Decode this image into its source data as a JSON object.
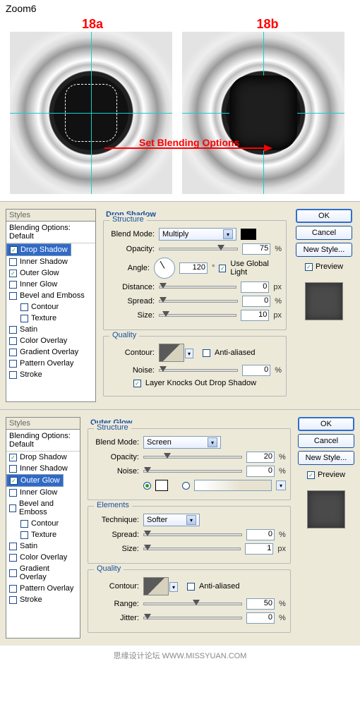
{
  "header": {
    "zoom": "Zoom6",
    "badges": [
      "18a",
      "18b"
    ],
    "arrow_label": "Set Blending Options"
  },
  "panels": [
    {
      "styles_title": "Styles",
      "blending_options": "Blending Options: Default",
      "items": [
        {
          "label": "Drop Shadow",
          "checked": true,
          "selected": true
        },
        {
          "label": "Inner Shadow",
          "checked": false
        },
        {
          "label": "Outer Glow",
          "checked": true
        },
        {
          "label": "Inner Glow",
          "checked": false
        },
        {
          "label": "Bevel and Emboss",
          "checked": false
        },
        {
          "label": "Contour",
          "checked": false,
          "indent": 1
        },
        {
          "label": "Texture",
          "checked": false,
          "indent": 1
        },
        {
          "label": "Satin",
          "checked": false
        },
        {
          "label": "Color Overlay",
          "checked": false
        },
        {
          "label": "Gradient Overlay",
          "checked": false
        },
        {
          "label": "Pattern Overlay",
          "checked": false
        },
        {
          "label": "Stroke",
          "checked": false
        }
      ],
      "title": "Drop Shadow",
      "structure": {
        "legend": "Structure",
        "blend_mode_label": "Blend Mode:",
        "blend_mode": "Multiply",
        "swatch": "#000000",
        "opacity_label": "Opacity:",
        "opacity": "75",
        "opacity_unit": "%",
        "opacity_pos": "74%",
        "angle_label": "Angle:",
        "angle": "120",
        "angle_unit": "°",
        "global_light_label": "Use Global Light",
        "global_light": true,
        "distance_label": "Distance:",
        "distance": "0",
        "distance_unit": "px",
        "distance_pos": "0%",
        "spread_label": "Spread:",
        "spread": "0",
        "spread_unit": "%",
        "spread_pos": "0%",
        "size_label": "Size:",
        "size": "10",
        "size_unit": "px",
        "size_pos": "4%"
      },
      "quality": {
        "legend": "Quality",
        "contour_label": "Contour:",
        "anti_alias_label": "Anti-aliased",
        "anti_alias": false,
        "noise_label": "Noise:",
        "noise": "0",
        "noise_unit": "%",
        "noise_pos": "0%",
        "knockout_label": "Layer Knocks Out Drop Shadow",
        "knockout": true
      },
      "buttons": {
        "ok": "OK",
        "cancel": "Cancel",
        "newstyle": "New Style...",
        "preview": "Preview",
        "preview_on": true
      }
    },
    {
      "styles_title": "Styles",
      "blending_options": "Blending Options: Default",
      "items": [
        {
          "label": "Drop Shadow",
          "checked": true
        },
        {
          "label": "Inner Shadow",
          "checked": false
        },
        {
          "label": "Outer Glow",
          "checked": true,
          "selected": true
        },
        {
          "label": "Inner Glow",
          "checked": false
        },
        {
          "label": "Bevel and Emboss",
          "checked": false
        },
        {
          "label": "Contour",
          "checked": false,
          "indent": 1
        },
        {
          "label": "Texture",
          "checked": false,
          "indent": 1
        },
        {
          "label": "Satin",
          "checked": false
        },
        {
          "label": "Color Overlay",
          "checked": false
        },
        {
          "label": "Gradient Overlay",
          "checked": false
        },
        {
          "label": "Pattern Overlay",
          "checked": false
        },
        {
          "label": "Stroke",
          "checked": false
        }
      ],
      "title": "Outer Glow",
      "structure": {
        "legend": "Structure",
        "blend_mode_label": "Blend Mode:",
        "blend_mode": "Screen",
        "opacity_label": "Opacity:",
        "opacity": "20",
        "opacity_unit": "%",
        "opacity_pos": "20%",
        "noise_label": "Noise:",
        "noise": "0",
        "noise_unit": "%",
        "noise_pos": "0%",
        "radio_color": true,
        "swatch": "#ffffff"
      },
      "elements": {
        "legend": "Elements",
        "technique_label": "Technique:",
        "technique": "Softer",
        "spread_label": "Spread:",
        "spread": "0",
        "spread_unit": "%",
        "spread_pos": "0%",
        "size_label": "Size:",
        "size": "1",
        "size_unit": "px",
        "size_pos": "0%"
      },
      "quality": {
        "legend": "Quality",
        "contour_label": "Contour:",
        "anti_alias_label": "Anti-aliased",
        "anti_alias": false,
        "range_label": "Range:",
        "range": "50",
        "range_unit": "%",
        "range_pos": "50%",
        "jitter_label": "Jitter:",
        "jitter": "0",
        "jitter_unit": "%",
        "jitter_pos": "0%"
      },
      "buttons": {
        "ok": "OK",
        "cancel": "Cancel",
        "newstyle": "New Style...",
        "preview": "Preview",
        "preview_on": true
      }
    }
  ],
  "footer": "思缘设计论坛    WWW.MISSYUAN.COM"
}
